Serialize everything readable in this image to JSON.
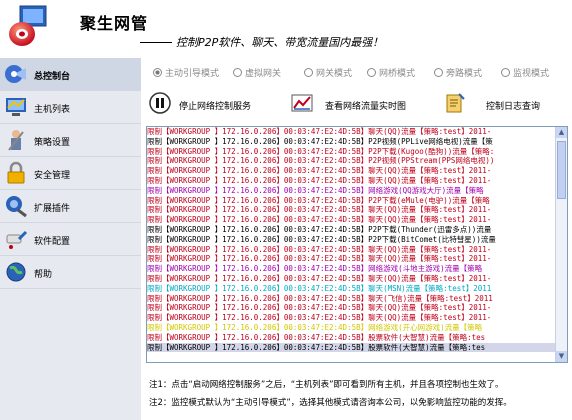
{
  "app": {
    "title": "聚生网管",
    "slogan": "控制P2P软件、聊天、带宽流量国内最强！"
  },
  "sidebar": {
    "items": [
      {
        "label": "总控制台",
        "icon": "console-icon",
        "active": true
      },
      {
        "label": "主机列表",
        "icon": "host-list-icon",
        "active": false
      },
      {
        "label": "策略设置",
        "icon": "policy-icon",
        "active": false
      },
      {
        "label": "安全管理",
        "icon": "lock-icon",
        "active": false
      },
      {
        "label": "扩展插件",
        "icon": "plugin-icon",
        "active": false
      },
      {
        "label": "软件配置",
        "icon": "config-icon",
        "active": false
      },
      {
        "label": "帮助",
        "icon": "help-globe-icon",
        "active": false
      }
    ]
  },
  "modes": [
    {
      "label": "主动引导模式",
      "selected": true
    },
    {
      "label": "虚拟网关",
      "selected": false
    },
    {
      "label": "网关模式",
      "selected": false
    },
    {
      "label": "网桥模式",
      "selected": false
    },
    {
      "label": "旁路模式",
      "selected": false
    },
    {
      "label": "监视模式",
      "selected": false
    }
  ],
  "toolbar": {
    "stop_label": "停止网络控制服务",
    "realtime_label": "查看网络流量实时图",
    "log_label": "控制日志查询"
  },
  "log_rows": [
    {
      "text": "限制【WORKGROUP     】172.16.0.206】00:03:47:E2:4D:5B】聊天(QQ)流量【策略:test】2011-",
      "color": "#c0001a"
    },
    {
      "text": "限制【WORKGROUP     】172.16.0.206】00:03:47:E2:4D:5B】P2P视频(PPLive网络电视)流量【策",
      "color": "#000000"
    },
    {
      "text": "限制【WORKGROUP     】172.16.0.206】00:03:47:E2:4D:5B】P2P下载(Kugoo(酷狗))流量【策略:",
      "color": "#c0001a"
    },
    {
      "text": "限制【WORKGROUP     】172.16.0.206】00:03:47:E2:4D:5B】P2P视频(PPStream(PPS网络电视))",
      "color": "#c0001a"
    },
    {
      "text": "限制【WORKGROUP     】172.16.0.206】00:03:47:E2:4D:5B】聊天(QQ)流量【策略:test】2011-",
      "color": "#c0001a"
    },
    {
      "text": "限制【WORKGROUP     】172.16.0.206】00:03:47:E2:4D:5B】聊天(QQ)流量【策略:test】2011-",
      "color": "#c0001a"
    },
    {
      "text": "限制【WORKGROUP     】172.16.0.206】00:03:47:E2:4D:5B】网络游戏(QQ游戏大厅)流量【策略",
      "color": "#a000b0"
    },
    {
      "text": "限制【WORKGROUP     】172.16.0.206】00:03:47:E2:4D:5B】P2P下载(eMule(电驴))流量【策略",
      "color": "#c0001a"
    },
    {
      "text": "限制【WORKGROUP     】172.16.0.206】00:03:47:E2:4D:5B】聊天(QQ)流量【策略:test】2011-",
      "color": "#c0001a"
    },
    {
      "text": "限制【WORKGROUP     】172.16.0.206】00:03:47:E2:4D:5B】聊天(QQ)流量【策略:test】2011-",
      "color": "#c0001a"
    },
    {
      "text": "限制【WORKGROUP     】172.16.0.206】00:03:47:E2:4D:5B】P2P下载(Thunder(迅雷多点))流量",
      "color": "#000000"
    },
    {
      "text": "限制【WORKGROUP     】172.16.0.206】00:03:47:E2:4D:5B】P2P下载(BitComet(比特彗星))流量",
      "color": "#000000"
    },
    {
      "text": "限制【WORKGROUP     】172.16.0.206】00:03:47:E2:4D:5B】聊天(QQ)流量【策略:test】2011-",
      "color": "#c0001a"
    },
    {
      "text": "限制【WORKGROUP     】172.16.0.206】00:03:47:E2:4D:5B】聊天(QQ)流量【策略:test】2011-",
      "color": "#c0001a"
    },
    {
      "text": "限制【WORKGROUP     】172.16.0.206】00:03:47:E2:4D:5B】网络游戏(斗地主游戏)流量【策略",
      "color": "#a000b0"
    },
    {
      "text": "限制【WORKGROUP     】172.16.0.206】00:03:47:E2:4D:5B】聊天(QQ)流量【策略:test】2011-",
      "color": "#c0001a"
    },
    {
      "text": "限制【WORKGROUP     】172.16.0.206】00:03:47:E2:4D:5B】聊天(MSN)流量【策略:test】2011",
      "color": "#00a8c8"
    },
    {
      "text": "限制【WORKGROUP     】172.16.0.206】00:03:47:E2:4D:5B】聊天(飞信)流量【策略:test】2011",
      "color": "#c0001a"
    },
    {
      "text": "限制【WORKGROUP     】172.16.0.206】00:03:47:E2:4D:5B】聊天(QQ)流量【策略:test】2011-",
      "color": "#c0001a"
    },
    {
      "text": "限制【WORKGROUP     】172.16.0.206】00:03:47:E2:4D:5B】聊天(QQ)流量【策略:test】2011-",
      "color": "#c0001a"
    },
    {
      "text": "限制【WORKGROUP     】172.16.0.206】00:03:47:E2:4D:5B】网络游戏(开心网游戏)流量【策略",
      "color": "#d4c800"
    },
    {
      "text": "限制【WORKGROUP     】172.16.0.206】00:03:47:E2:4D:5B】股票软件(大智慧)流量【策略:tes",
      "color": "#c0001a"
    },
    {
      "text": "限制【WORKGROUP     】172.16.0.206】00:03:47:E2:4D:5B】股票软件(大智慧)流量【策略:tes",
      "color": "#000000",
      "selected": true
    }
  ],
  "notes": [
    "注1：点击“启动网络控制服务”之后，“主机列表”即可看到所有主机，并且各项控制也生效了。",
    "注2：监控模式默认为“主动引导模式”，选择其他模式请咨询本公司，以免影响监控功能的发挥。"
  ]
}
